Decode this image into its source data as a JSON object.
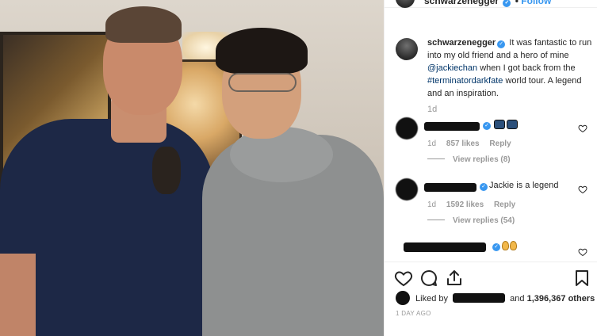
{
  "header": {
    "username": "schwarzenegger",
    "follow_label": "Follow"
  },
  "caption": {
    "username": "schwarzenegger",
    "text_part1": "It was fantastic to run into my old friend and a hero of mine",
    "mention": "@jackiechan",
    "text_part2": "when I got back from the",
    "hashtag": "#terminatordarkfate",
    "text_part3": "world tour. A legend and an inspiration.",
    "time": "1d"
  },
  "comments": [
    {
      "text": "",
      "emoji": "sunglasses-emoji",
      "time": "1d",
      "likes": "857 likes",
      "reply_label": "Reply",
      "view_replies": "View replies (8)"
    },
    {
      "text": "Jackie is a legend",
      "time": "1d",
      "likes": "1592 likes",
      "reply_label": "Reply",
      "view_replies": "View replies (54)"
    },
    {
      "text": "",
      "emoji": "praying-hands-emoji"
    }
  ],
  "actions": {
    "liked_by_prefix": "Liked by",
    "liked_by_suffix": "and",
    "others_count": "1,396,367 others",
    "timestamp": "1 DAY AGO"
  },
  "colors": {
    "link": "#003569",
    "follow": "#3897f0",
    "verified": "#3897f0",
    "meta": "#999999"
  },
  "icons": [
    "heart-icon",
    "comment-icon",
    "share-icon",
    "bookmark-icon",
    "verified-icon"
  ]
}
